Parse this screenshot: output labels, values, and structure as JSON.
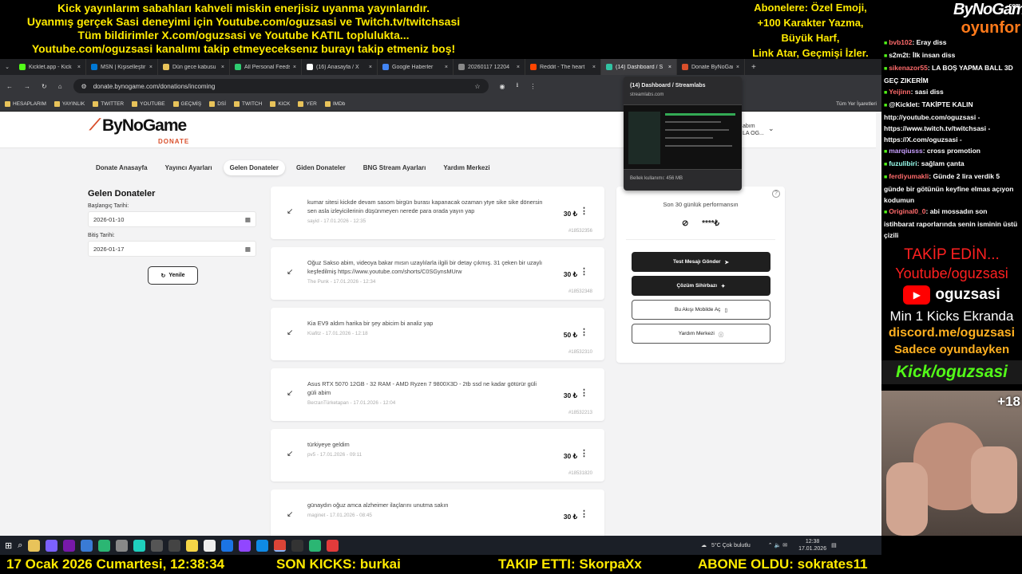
{
  "overlay": {
    "top_lines": [
      "Kick yayınlarım sabahları kahveli miskin enerjisiz uyanma yayınlarıdır.",
      "Uyanmış gerçek Sasi deneyimi için Youtube.com/oguzsasi ve Twitch.tv/twitchsasi",
      "Tüm bildirimler X.com/oguzsasi ve Youtube KATIL toplulukta...",
      "Youtube.com/oguzsasi kanalımı takip etmeyeceksenız burayı takip etmeniz boş!"
    ],
    "right_lines": [
      "Abonelere: Özel Emoji,",
      "+100 Karakter Yazma,",
      "Büyük Harf,",
      "Link Atar, Geçmişi İzler."
    ],
    "brand_top": "ByNoGame",
    "brand_com": ".com",
    "brand_bottom": "oyunfor",
    "bottom_date": "17 Ocak 2026 Cumartesi, 12:38:34",
    "bottom_kicks": "SON KICKS: burkai",
    "bottom_follow": "TAKIP ETTI: SkorpaXx",
    "bottom_sub": "ABONE OLDU: sokrates11",
    "cam_badge": "+18"
  },
  "chat": [
    {
      "user": "bvb102",
      "text": ": Eray diss",
      "color": "#ff6b6b"
    },
    {
      "user": "s2m2t",
      "text": ": İlk insan diss",
      "color": "#ffffff"
    },
    {
      "user": "sikenazor55",
      "text": ": LA BOŞ YAPMA BALL 3D GEÇ ZIKERİM",
      "color": "#ff6b6b"
    },
    {
      "user": "Yeijinn",
      "text": ": sasi diss",
      "color": "#ff6b6b"
    },
    {
      "user": "@Kicklet",
      "text": ": TAKİPTE KALIN http://youtube.com/oguzsasi - https://www.twitch.tv/twitchsasi - https://X.com/oguzsasi -",
      "color": "#ffffff"
    },
    {
      "user": "marqiusss",
      "text": ": cross promotion",
      "color": "#c9a0ff"
    },
    {
      "user": "fuzulibiri",
      "text": ": sağlam çanta",
      "color": "#9fe"
    },
    {
      "user": "ferdiyumakli",
      "text": ": Günde 2 lira verdik 5 günde bir götünün keyfine elmas açıyon kodumun",
      "color": "#ff6b6b"
    },
    {
      "user": "Original0_0",
      "text": ": abi mossadın son istihbarat raporlarında senin isminin üstü çizili",
      "color": "#ff6b6b"
    }
  ],
  "promo": {
    "takip": "TAKİP EDİN...",
    "youtube": "Youtube/oguzsasi",
    "yt_name": "oguzsasi",
    "kicks": "Min 1 Kicks Ekranda",
    "discord": "discord.me/oguzsasi",
    "oyunda": "Sadece oyundayken",
    "kick": "Kick/oguzsasi"
  },
  "browser": {
    "tabs": [
      {
        "label": "Kicklet.app - Kick",
        "color": "#53fc18"
      },
      {
        "label": "MSN | Kişiselleştir",
        "color": "#0078d4"
      },
      {
        "label": "Dün gece kabusu",
        "color": "#e8c35a"
      },
      {
        "label": "All Personal Feeds",
        "color": "#2ecc71"
      },
      {
        "label": "(16) Anasayfa / X",
        "color": "#ffffff"
      },
      {
        "label": "Google Haberler",
        "color": "#4285f4"
      },
      {
        "label": "20260117 12204",
        "color": "#888888"
      },
      {
        "label": "Reddit - The heart",
        "color": "#ff4500"
      },
      {
        "label": "(14) Dashboard / S",
        "color": "#31c3a2"
      },
      {
        "label": "Donate ByNoGame",
        "color": "#d94f2b"
      }
    ],
    "url": "donate.bynogame.com/donations/incoming",
    "bookmarks": [
      "HESAPLARIM",
      "YAYINLIK",
      "TWITTER",
      "YOUTUBE",
      "GEÇMİŞ",
      "DSİ",
      "TWITCH",
      "KICK",
      "YER",
      "IMDb"
    ],
    "bookmarks_right": "Tüm Yer İşaretleri",
    "bm_partial": "WSER-G",
    "tooltip": {
      "title": "(14) Dashboard / Streamlabs",
      "site": "streamlabs.com",
      "memory": "Bellek kullanımı: 456 MB"
    }
  },
  "site": {
    "logo": "ByNoGame",
    "logo_sub": "DONATE",
    "account_line1": "abım",
    "account_line2": "LA OG...",
    "nav": [
      "Donate Anasayfa",
      "Yayıncı Ayarları",
      "Gelen Donateler",
      "Giden Donateler",
      "BNG Stream Ayarları",
      "Yardım Merkezi"
    ],
    "filter_title": "Gelen Donateler",
    "start_label": "Başlangıç Tarihi:",
    "start_value": "2026-01-10",
    "end_label": "Bitiş Tarihi:",
    "end_value": "2026-01-17",
    "refresh_label": "Yenile",
    "donations": [
      {
        "msg": "kumar sitesi kickde devam sasom birgün burası kapanacak ozaman ytye sike sike dönersin sen asla izleyicilerinin düşünmeyen nerede para orada yayın yap",
        "meta": "sayid - 17.01.2026 - 12:35",
        "amount": "30 ₺",
        "id": "#18532356"
      },
      {
        "msg": "Oğuz Sakso abim, videoya bakar mısın uzaylılarla ilgili bir detay çıkmış. 31 çeken bir uzaylı keşfedilmiş https://www.youtube.com/shorts/C0SGynsMUrw",
        "meta": "The Punk - 17.01.2026 - 12:34",
        "amount": "30 ₺",
        "id": "#18532348"
      },
      {
        "msg": "Kia EV9 aldım harika bir şey abicim bi analiz yap",
        "meta": "Kiafitz - 17.01.2026 - 12:18",
        "amount": "50 ₺",
        "id": "#18532310"
      },
      {
        "msg": "Asus RTX 5070 12GB - 32 RAM - AMD Ryzen 7 9800X3D - 2tb ssd ne kadar götürür güli güli abim",
        "meta": "BerzanTürketapan - 17.01.2026 - 12:04",
        "amount": "30 ₺",
        "id": "#18532213"
      },
      {
        "msg": "türkiyeye geldim",
        "meta": "pv5 - 17.01.2026 - 09:11",
        "amount": "30 ₺",
        "id": "#18531820"
      },
      {
        "msg": "günaydın oğuz amca alzheimer ilaçlarını unutma sakın",
        "meta": "maginet - 17.01.2026 - 08:45",
        "amount": "30 ₺",
        "id": ""
      }
    ],
    "perf_title": "Son 30 günlük performansın",
    "perf_value": "****₺",
    "buttons": [
      "Test Mesajı Gönder",
      "Çözüm Sihirbazı",
      "Bu Akışı Mobilde Aç",
      "Yardım Merkezi"
    ]
  },
  "tray": {
    "weather": "5°C  Çok bulutlu",
    "time": "12:38",
    "date": "17.01.2026"
  }
}
